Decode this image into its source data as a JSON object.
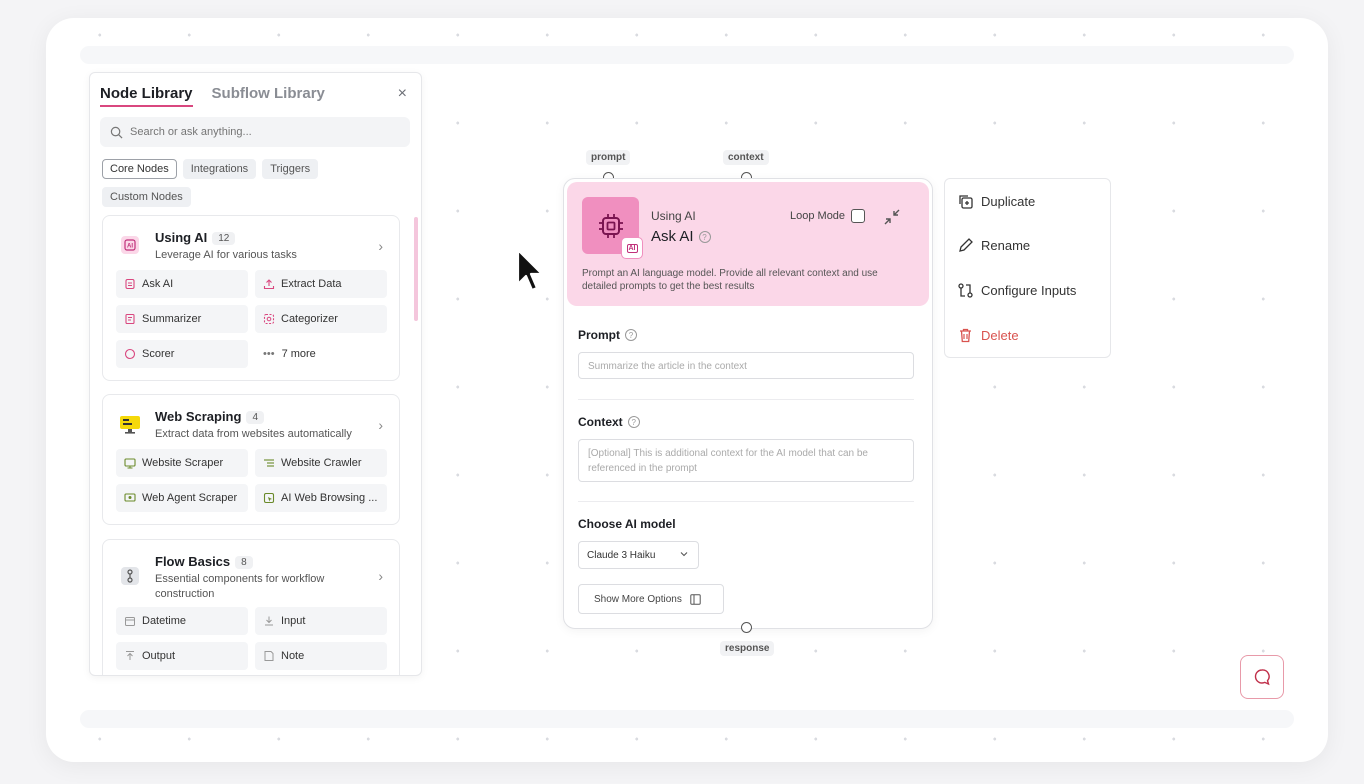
{
  "library": {
    "tabs": [
      "Node Library",
      "Subflow Library"
    ],
    "close": "×",
    "search_placeholder": "Search or ask anything...",
    "filters": [
      "Core Nodes",
      "Integrations",
      "Triggers",
      "Custom Nodes"
    ],
    "categories": [
      {
        "title": "Using AI",
        "count": "12",
        "desc": "Leverage AI for various tasks",
        "items": [
          "Ask AI",
          "Extract Data",
          "Summarizer",
          "Categorizer",
          "Scorer",
          "7 more"
        ]
      },
      {
        "title": "Web Scraping",
        "count": "4",
        "desc": "Extract data from websites automatically",
        "items": [
          "Website Scraper",
          "Website Crawler",
          "Web Agent Scraper",
          "AI Web Browsing ..."
        ]
      },
      {
        "title": "Flow Basics",
        "count": "8",
        "desc": "Essential components for workflow construction",
        "items": [
          "Datetime",
          "Input",
          "Output",
          "Note"
        ]
      }
    ]
  },
  "node": {
    "ports": {
      "prompt": "prompt",
      "context": "context",
      "response": "response"
    },
    "icon_badge": "AI",
    "kicker": "Using AI",
    "title": "Ask AI",
    "loop_label": "Loop Mode",
    "description": "Prompt an AI language model. Provide all relevant context and use detailed prompts to get the best results",
    "prompt_label": "Prompt",
    "prompt_placeholder": "Summarize the article in the context",
    "context_label": "Context",
    "context_placeholder": "[Optional] This is additional context for the AI model that can be referenced in the prompt",
    "model_label": "Choose AI model",
    "model_value": "Claude 3 Haiku",
    "more_options": "Show More Options"
  },
  "menu": {
    "duplicate": "Duplicate",
    "rename": "Rename",
    "configure": "Configure Inputs",
    "delete": "Delete"
  },
  "colors": {
    "accent": "#d9477f",
    "node_head": "#fbd7e8",
    "node_icon": "#f08fbf",
    "danger": "#d9534f"
  }
}
